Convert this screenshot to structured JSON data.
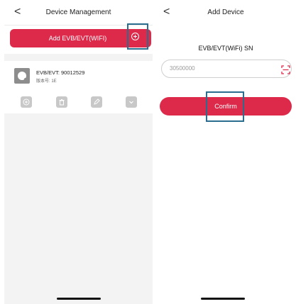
{
  "left_screen": {
    "back_glyph": "<",
    "title": "Device Management",
    "add_button_label": "Add EVB/EVT(WIFI)",
    "device": {
      "sn": "EVB/EVT: 90012529",
      "version": "版本号: 1E",
      "icon": "gear-icon"
    },
    "actions": [
      "add-icon",
      "trash-icon",
      "edit-icon",
      "chevron-down-icon"
    ]
  },
  "right_screen": {
    "back_glyph": "<",
    "title": "Add Device",
    "field_label": "EVB/EVT(WiFi) SN",
    "sn_value": "30500000",
    "confirm_label": "Confirm",
    "scan_icon": "scan-icon"
  },
  "colors": {
    "accent": "#dd2a4b",
    "highlight_box": "#2b6d8f",
    "page_bg": "#f3f3f3"
  }
}
